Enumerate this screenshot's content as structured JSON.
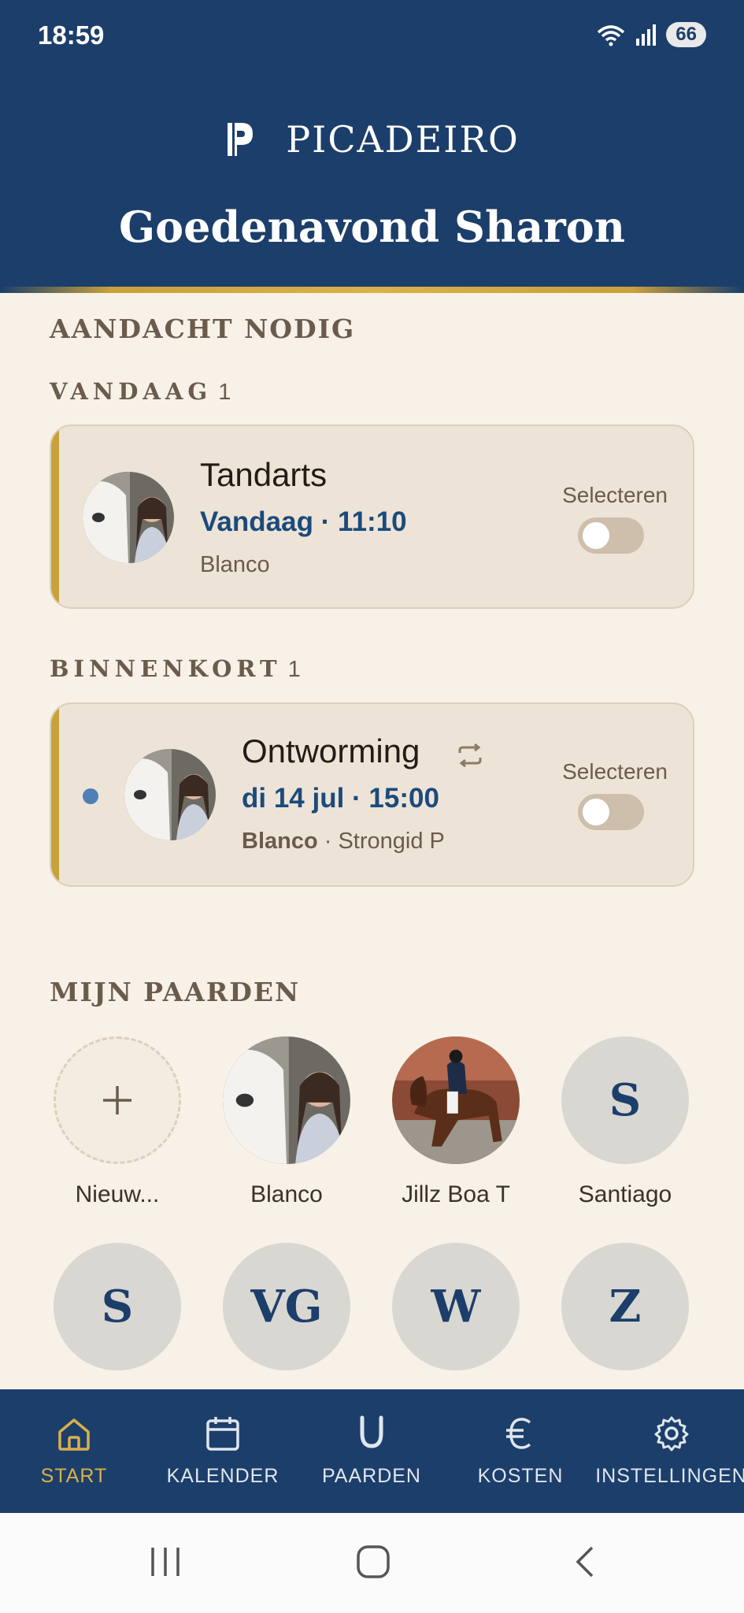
{
  "status": {
    "time": "18:59",
    "battery": "66"
  },
  "header": {
    "logo_text": "PICADEIRO",
    "greeting": "Goedenavond Sharon"
  },
  "attention": {
    "title": "AANDACHT NODIG",
    "today": {
      "label": "VANDAAG",
      "count": "1",
      "item": {
        "title": "Tandarts",
        "when": "Vandaag · 11:10",
        "horse": "Blanco",
        "select_label": "Selecteren"
      }
    },
    "soon": {
      "label": "BINNENKORT",
      "count": "1",
      "item": {
        "title": "Ontworming",
        "when": "di 14 jul · 15:00",
        "horse": "Blanco",
        "detail": " · Strongid P",
        "select_label": "Selecteren"
      }
    }
  },
  "horses": {
    "title": "MIJN PAARDEN",
    "row1": [
      {
        "name": "Nieuw...",
        "type": "add"
      },
      {
        "name": "Blanco",
        "type": "photo"
      },
      {
        "name": "Jillz Boa T",
        "type": "photo"
      },
      {
        "name": "Santiago",
        "initials": "S"
      }
    ],
    "row2": [
      {
        "initials": "S"
      },
      {
        "initials": "VG"
      },
      {
        "initials": "W"
      },
      {
        "initials": "Z"
      }
    ]
  },
  "nav": [
    {
      "label": "START",
      "icon": "home-icon",
      "active": true
    },
    {
      "label": "KALENDER",
      "icon": "calendar-icon"
    },
    {
      "label": "PAARDEN",
      "icon": "horseshoe-icon"
    },
    {
      "label": "KOSTEN",
      "icon": "euro-icon"
    },
    {
      "label": "INSTELLINGEN",
      "icon": "gear-icon"
    }
  ],
  "colors": {
    "primary": "#1c3e6a",
    "accent": "#c9a13b",
    "background": "#f7f1e7"
  }
}
